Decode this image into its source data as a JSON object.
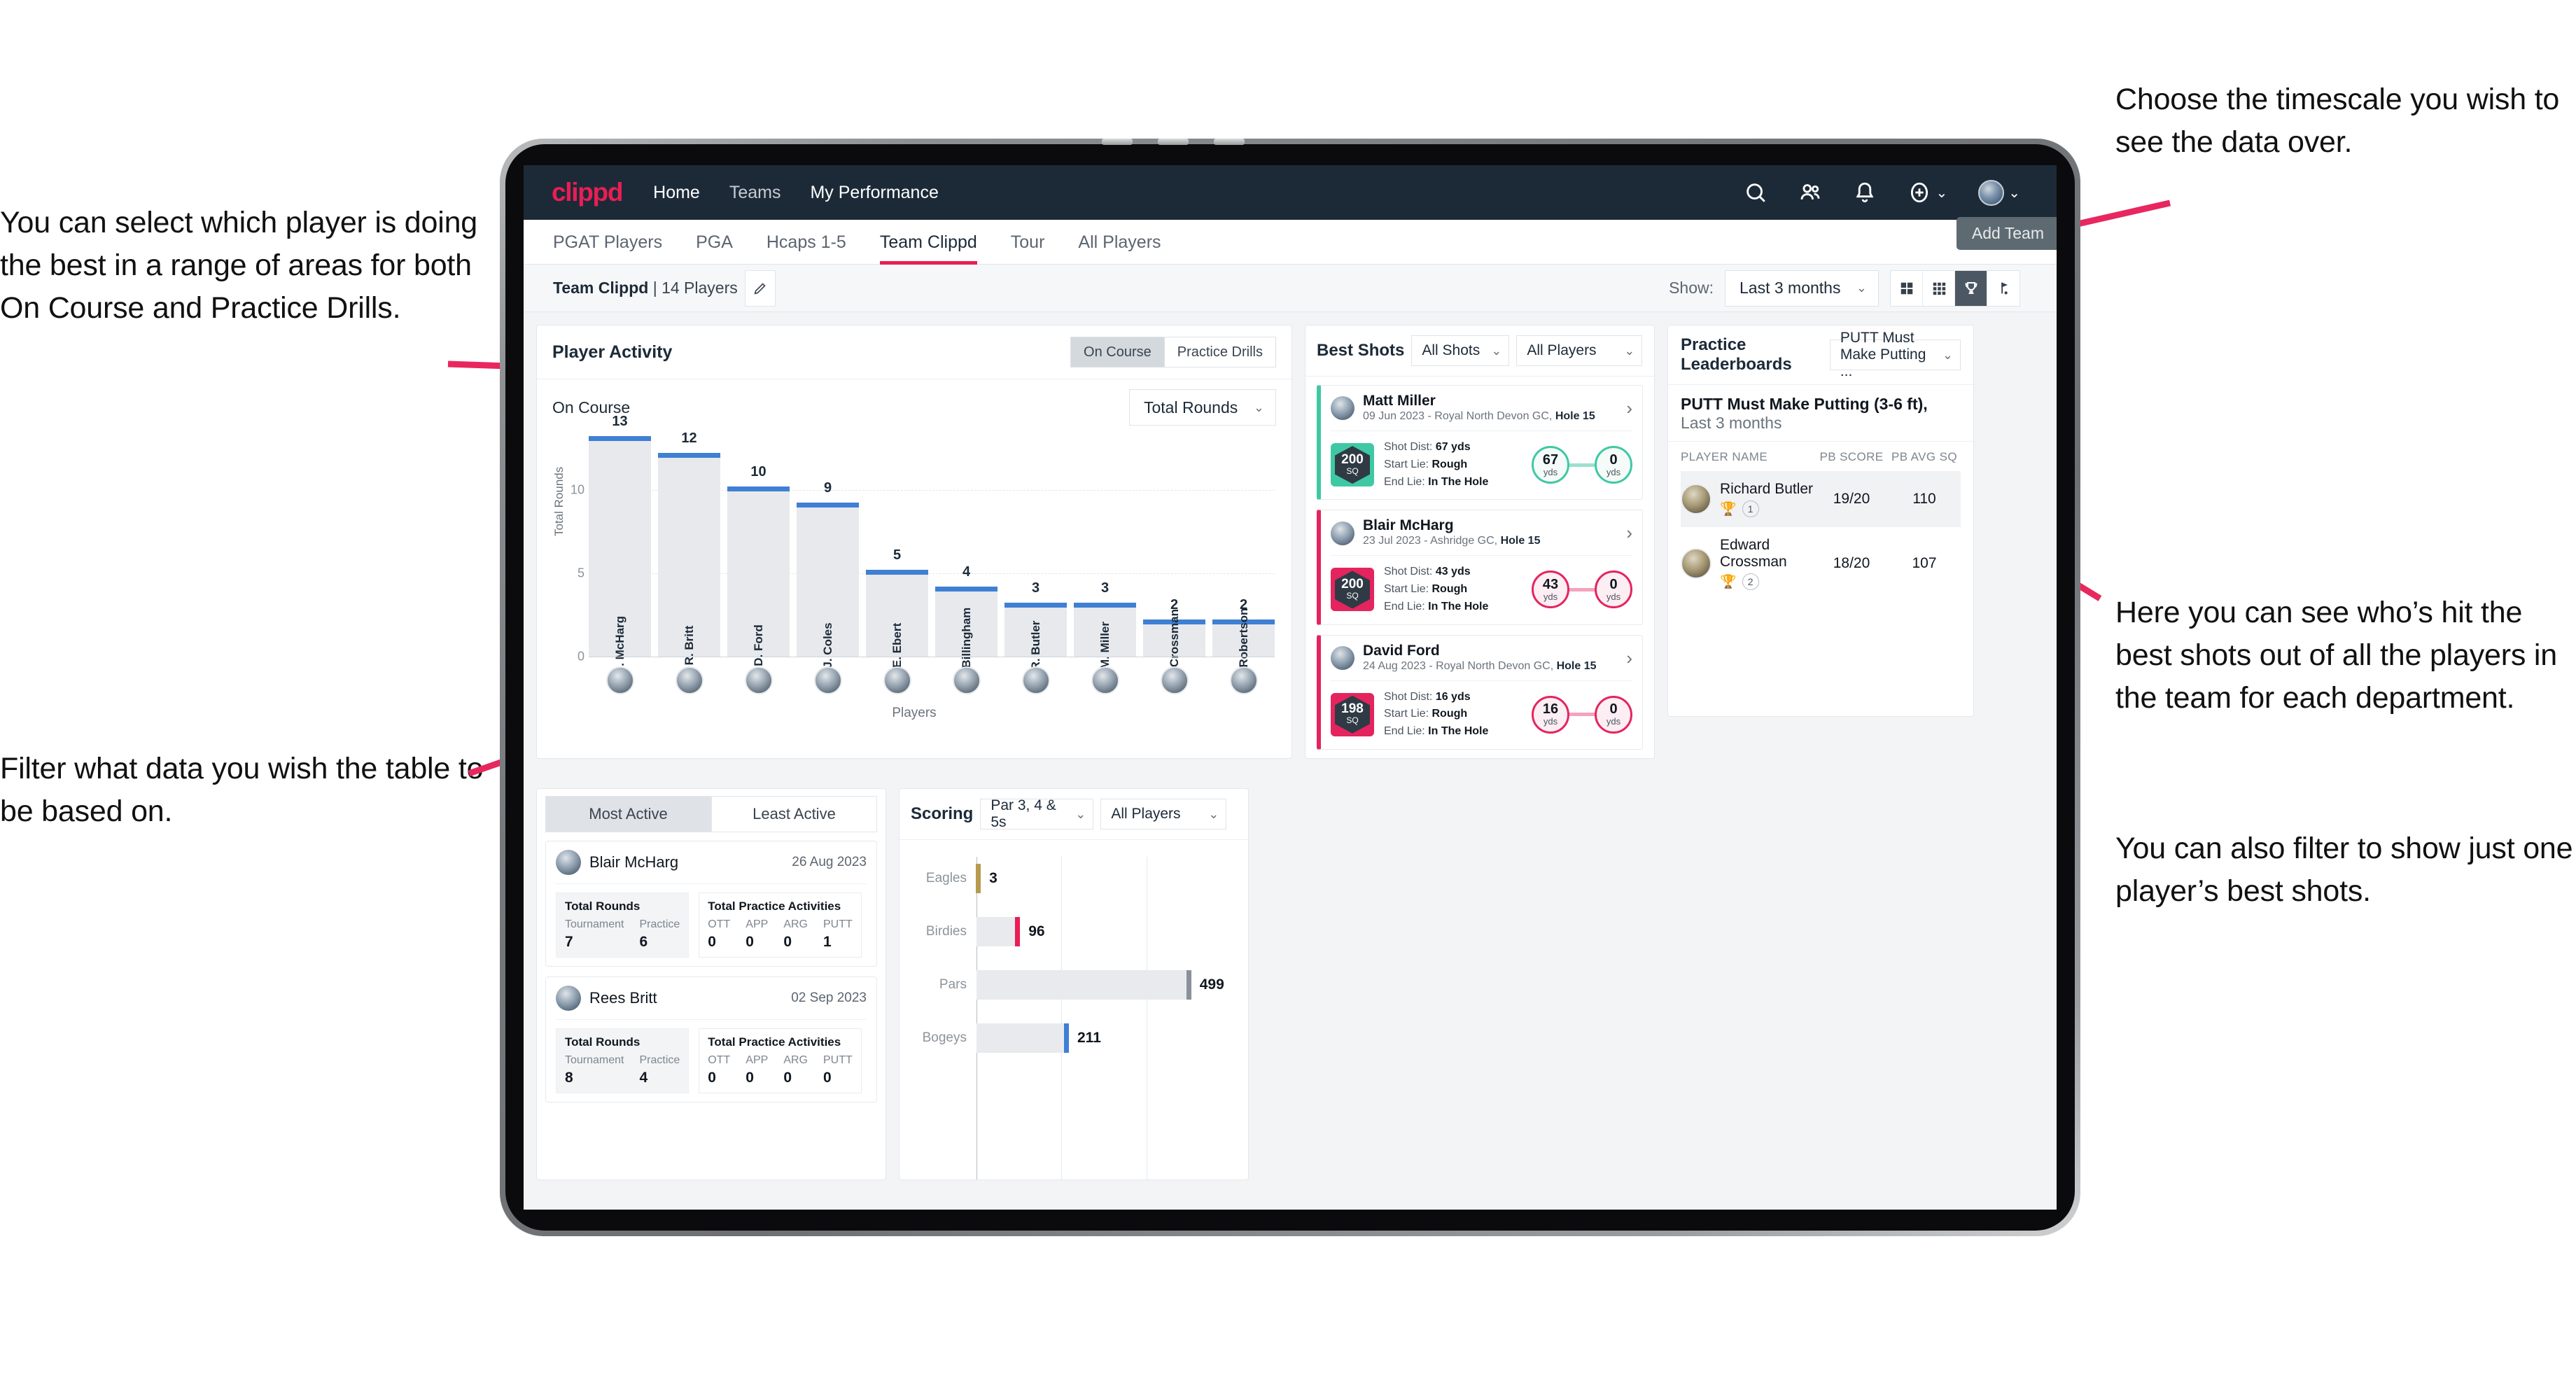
{
  "annotations": {
    "left_top": "You can select which player is doing the best in a range of areas for both On Course and Practice Drills.",
    "left_bottom": "Filter what data you wish the table to be based on.",
    "right_top": "Choose the timescale you wish to see the data over.",
    "right_middle": "Here you can see who’s hit the best shots out of all the players in the team for each department.",
    "right_bottom": "You can also filter to show just one player’s best shots."
  },
  "topnav": {
    "logo": "clippd",
    "links": [
      {
        "label": "Home",
        "active": true
      },
      {
        "label": "Teams",
        "active": false
      },
      {
        "label": "My Performance",
        "active": false
      }
    ],
    "icons": [
      "search-icon",
      "people-icon",
      "bell-icon",
      "plus-circle-icon",
      "avatar-icon"
    ]
  },
  "subtabs": {
    "items": [
      {
        "label": "PGAT Players",
        "active": false
      },
      {
        "label": "PGA",
        "active": false
      },
      {
        "label": "Hcaps 1-5",
        "active": false
      },
      {
        "label": "Team Clippd",
        "active": true
      },
      {
        "label": "Tour",
        "active": false
      },
      {
        "label": "All Players",
        "active": false
      }
    ],
    "tooltip": "Add Team"
  },
  "toolbar": {
    "team_name": "Team Clippd",
    "team_count": "| 14 Players",
    "edit_icon": "pencil-icon",
    "show_label": "Show:",
    "timescale_value": "Last 3 months",
    "view_buttons": [
      {
        "name": "grid-2x2-view",
        "active": false
      },
      {
        "name": "grid-3x3-view",
        "active": false
      },
      {
        "name": "trophy-view",
        "active": true
      },
      {
        "name": "flag-view",
        "active": false
      }
    ]
  },
  "player_activity": {
    "title": "Player Activity",
    "toggle": [
      {
        "label": "On Course",
        "active": true
      },
      {
        "label": "Practice Drills",
        "active": false
      }
    ],
    "subtitle": "On Course",
    "metric_select": "Total Rounds"
  },
  "best_shots": {
    "title": "Best Shots",
    "shot_filter": "All Shots",
    "player_filter": "All Players",
    "items": [
      {
        "player": "Matt Miller",
        "meta_date": "09 Jun 2023 - Royal North Devon GC,",
        "meta_hole": "Hole 15",
        "sq": "200",
        "sq_unit": "SQ",
        "shot_dist_label": "Shot Dist:",
        "shot_dist": "67 yds",
        "start_lie_label": "Start Lie:",
        "start_lie": "Rough",
        "end_lie_label": "End Lie:",
        "end_lie": "In The Hole",
        "from_value": "67",
        "from_unit": "yds",
        "to_value": "0",
        "to_unit": "yds",
        "color": "#3fc8a4"
      },
      {
        "player": "Blair McHarg",
        "meta_date": "23 Jul 2023 - Ashridge GC,",
        "meta_hole": "Hole 15",
        "sq": "200",
        "sq_unit": "SQ",
        "shot_dist_label": "Shot Dist:",
        "shot_dist": "43 yds",
        "start_lie_label": "Start Lie:",
        "start_lie": "Rough",
        "end_lie_label": "End Lie:",
        "end_lie": "In The Hole",
        "from_value": "43",
        "from_unit": "yds",
        "to_value": "0",
        "to_unit": "yds",
        "color": "#e8days"
      },
      {
        "player": "David Ford",
        "meta_date": "24 Aug 2023 - Royal North Devon GC,",
        "meta_hole": "Hole 15",
        "sq": "198",
        "sq_unit": "SQ",
        "shot_dist_label": "Shot Dist:",
        "shot_dist": "16 yds",
        "start_lie_label": "Start Lie:",
        "start_lie": "Rough",
        "end_lie_label": "End Lie:",
        "end_lie": "In The Hole",
        "from_value": "16",
        "from_unit": "yds",
        "to_value": "0",
        "to_unit": "yds",
        "color": "#e4245e"
      }
    ]
  },
  "practice_leaderboards": {
    "title": "Practice Leaderboards",
    "drill_select": "PUTT Must Make Putting ...",
    "drill_title": "PUTT Must Make Putting (3-6 ft),",
    "drill_period": "Last 3 months",
    "columns": [
      "PLAYER NAME",
      "PB SCORE",
      "PB AVG SQ"
    ],
    "rows": [
      {
        "name": "Richard Butler",
        "rank": "1",
        "trophy": "gold",
        "pb_score": "19/20",
        "pb_avg_sq": "110"
      },
      {
        "name": "Edward Crossman",
        "rank": "2",
        "trophy": "silver",
        "pb_score": "18/20",
        "pb_avg_sq": "107"
      }
    ]
  },
  "activity": {
    "tabs": [
      {
        "label": "Most Active",
        "active": true
      },
      {
        "label": "Least Active",
        "active": false
      }
    ],
    "rounds_title": "Total Rounds",
    "practice_title": "Total Practice Activities",
    "rounds_cols": [
      "Tournament",
      "Practice"
    ],
    "practice_cols": [
      "OTT",
      "APP",
      "ARG",
      "PUTT"
    ],
    "items": [
      {
        "name": "Blair McHarg",
        "date": "26 Aug 2023",
        "tournament": "7",
        "practice": "6",
        "ott": "0",
        "app": "0",
        "arg": "0",
        "putt": "1"
      },
      {
        "name": "Rees Britt",
        "date": "02 Sep 2023",
        "tournament": "8",
        "practice": "4",
        "ott": "0",
        "app": "0",
        "arg": "0",
        "putt": "0"
      }
    ]
  },
  "scoring": {
    "title": "Scoring",
    "par_filter": "Par 3, 4 & 5s",
    "player_filter": "All Players"
  },
  "chart_data": [
    {
      "type": "bar",
      "title": "Player Activity — On Course",
      "xlabel": "Players",
      "ylabel": "Total Rounds",
      "ylim": [
        0,
        13
      ],
      "yticks": [
        0,
        5,
        10
      ],
      "grid": true,
      "categories": [
        "B. McHarg",
        "R. Britt",
        "D. Ford",
        "J. Coles",
        "E. Ebert",
        "D. Billingham",
        "R. Butler",
        "M. Miller",
        "E. Crossman",
        "C. Robertson"
      ],
      "values": [
        13,
        12,
        10,
        9,
        5,
        4,
        3,
        3,
        2,
        2
      ],
      "bar_color": "#e7e9ec",
      "cap_color": "#3f7fd4"
    },
    {
      "type": "bar",
      "orientation": "horizontal",
      "title": "Scoring",
      "xlabel": "",
      "ylabel": "",
      "xlim": [
        0,
        600
      ],
      "grid": true,
      "categories": [
        "Eagles",
        "Birdies",
        "Pars",
        "Bogeys"
      ],
      "values": [
        3,
        96,
        499,
        211
      ],
      "colors": [
        "#b79a4e",
        "#ea1d55",
        "#8a9199",
        "#3f7fd4"
      ]
    }
  ]
}
